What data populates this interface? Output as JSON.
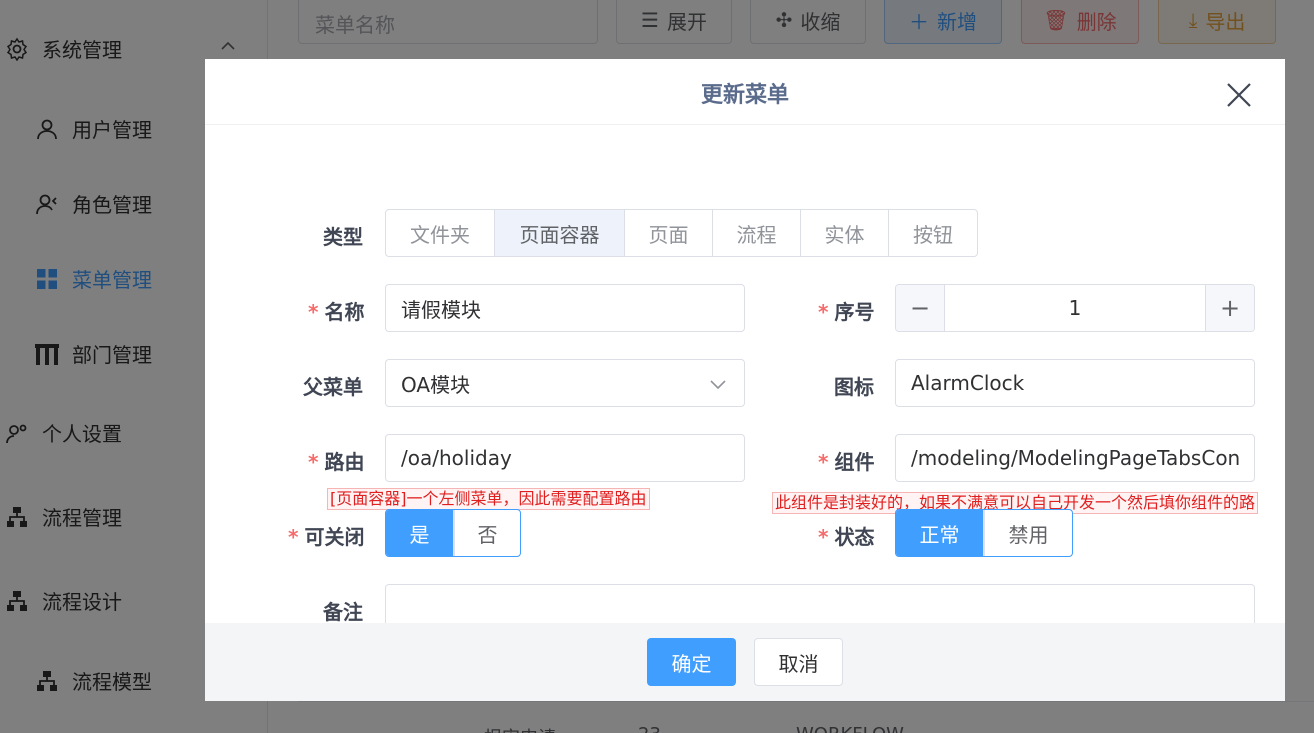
{
  "sidebar": {
    "items": [
      {
        "label": "系统管理",
        "icon": "gear-icon"
      },
      {
        "label": "用户管理",
        "icon": "user-icon"
      },
      {
        "label": "角色管理",
        "icon": "users-icon"
      },
      {
        "label": "菜单管理",
        "icon": "grid-menu-icon"
      },
      {
        "label": "部门管理",
        "icon": "department-icon"
      },
      {
        "label": "个人设置",
        "icon": "user-settings-icon"
      },
      {
        "label": "流程管理",
        "icon": "flow-icon"
      },
      {
        "label": "流程设计",
        "icon": "flow-icon"
      },
      {
        "label": "流程模型",
        "icon": "flow-icon"
      }
    ]
  },
  "toolbar": {
    "search_placeholder": "菜单名称",
    "expand": "展开",
    "collapse": "收缩",
    "add": "新增",
    "delete": "删除",
    "export": "导出",
    "colors": {
      "add": "#409eff",
      "delete": "#f56c6c",
      "export": "#e6a23c"
    }
  },
  "table": {
    "partial_row": [
      "报审申请",
      "23",
      "WORKFLOW",
      "..."
    ]
  },
  "dialog": {
    "title": "更新菜单",
    "type": {
      "label": "类型",
      "options": [
        "文件夹",
        "页面容器",
        "页面",
        "流程",
        "实体",
        "按钮"
      ],
      "selected": "页面容器"
    },
    "name": {
      "label": "名称",
      "value": "请假模块"
    },
    "order": {
      "label": "序号",
      "value": "1",
      "minus": "−",
      "plus": "+"
    },
    "parent": {
      "label": "父菜单",
      "value": "OA模块"
    },
    "icon": {
      "label": "图标",
      "value": "AlarmClock"
    },
    "route": {
      "label": "路由",
      "value": "/oa/holiday"
    },
    "component": {
      "label": "组件",
      "value": "/modeling/ModelingPageTabsContainer"
    },
    "closable": {
      "label": "可关闭",
      "options": [
        "是",
        "否"
      ],
      "selected": "是"
    },
    "status": {
      "label": "状态",
      "options": [
        "正常",
        "禁用"
      ],
      "selected": "正常"
    },
    "remark": {
      "label": "备注",
      "value": ""
    },
    "annotation_route": "[页面容器]一个左侧菜单，因此需要配置路由",
    "annotation_component": "此组件是封装好的，如果不满意可以自己开发一个然后填你组件的路",
    "confirm": "确定",
    "cancel": "取消",
    "required_mark": "*"
  },
  "colors": {
    "primary": "#409eff",
    "required": "#f56c6c",
    "annotation": "#e02020"
  }
}
